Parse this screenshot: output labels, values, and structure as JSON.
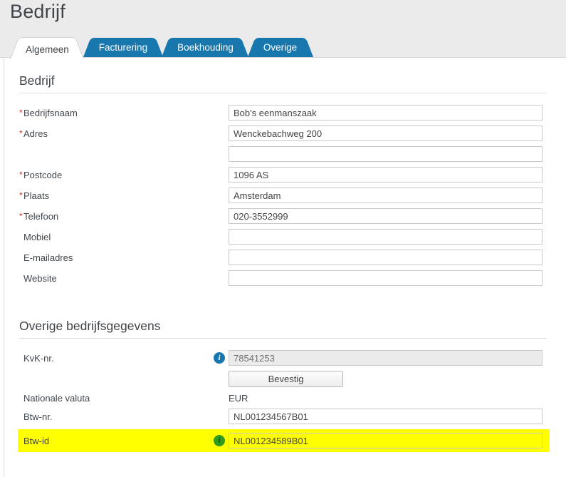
{
  "page": {
    "title": "Bedrijf"
  },
  "required_marker": "*",
  "tabs": [
    {
      "label": "Algemeen",
      "active": true
    },
    {
      "label": "Facturering",
      "active": false
    },
    {
      "label": "Boekhouding",
      "active": false
    },
    {
      "label": "Overige",
      "active": false
    }
  ],
  "colors": {
    "tab_blue": "#1878ad",
    "header_bg": "#ebebeb",
    "highlight_yellow": "#ffff00",
    "required_red": "#c9342c",
    "info_icon_blue": "#1878ad",
    "info_icon_green": "#2f9c1f"
  },
  "section_general": {
    "title": "Bedrijf",
    "fields": [
      {
        "label": "Bedrijfsnaam",
        "required": true,
        "value": "Bob's eenmanszaak"
      },
      {
        "label": "Adres",
        "required": true,
        "value": "Wenckebachweg 200"
      },
      {
        "label": "",
        "required": false,
        "value": ""
      },
      {
        "label": "Postcode",
        "required": true,
        "value": "1096 AS"
      },
      {
        "label": "Plaats",
        "required": true,
        "value": "Amsterdam"
      },
      {
        "label": "Telefoon",
        "required": true,
        "value": "020-3552999"
      },
      {
        "label": "Mobiel",
        "required": false,
        "value": ""
      },
      {
        "label": "E-mailadres",
        "required": false,
        "value": ""
      },
      {
        "label": "Website",
        "required": false,
        "value": ""
      }
    ]
  },
  "section_other": {
    "title": "Overige bedrijfsgegevens",
    "kvk": {
      "label": "KvK-nr.",
      "value": "78541253",
      "disabled": true,
      "info_icon": "blue-info-icon",
      "icon_glyph": "i"
    },
    "confirm_button": {
      "label": "Bevestig"
    },
    "currency": {
      "label": "Nationale valuta",
      "value": "EUR"
    },
    "btw_nr": {
      "label": "Btw-nr.",
      "value": "NL001234567B01"
    },
    "btw_id": {
      "label": "Btw-id",
      "value": "NL001234589B01",
      "info_icon": "green-info-icon",
      "icon_glyph": "i",
      "highlighted": true
    }
  }
}
